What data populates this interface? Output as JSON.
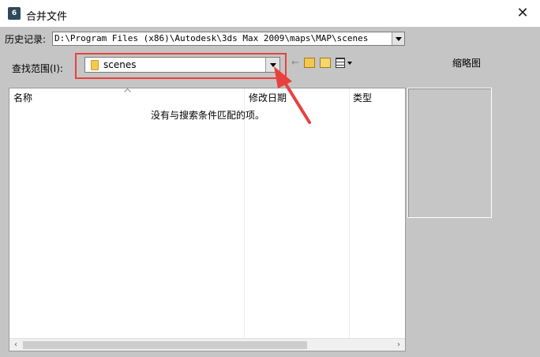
{
  "window": {
    "title": "合并文件",
    "app_icon_label": "6",
    "close_glyph": "✕"
  },
  "history": {
    "label": "历史记录:",
    "value": "D:\\Program Files (x86)\\Autodesk\\3ds Max 2009\\maps\\MAP\\scenes"
  },
  "lookin": {
    "label": "查找范围(I):",
    "value": "scenes"
  },
  "thumbnail": {
    "label": "缩略图"
  },
  "file_list": {
    "columns": [
      "名称",
      "修改日期",
      "类型"
    ],
    "empty_message": "没有与搜索条件匹配的项。"
  },
  "scrollbar": {
    "left_glyph": "‹",
    "right_glyph": "›"
  },
  "annotation": {
    "color": "#e8413d"
  }
}
